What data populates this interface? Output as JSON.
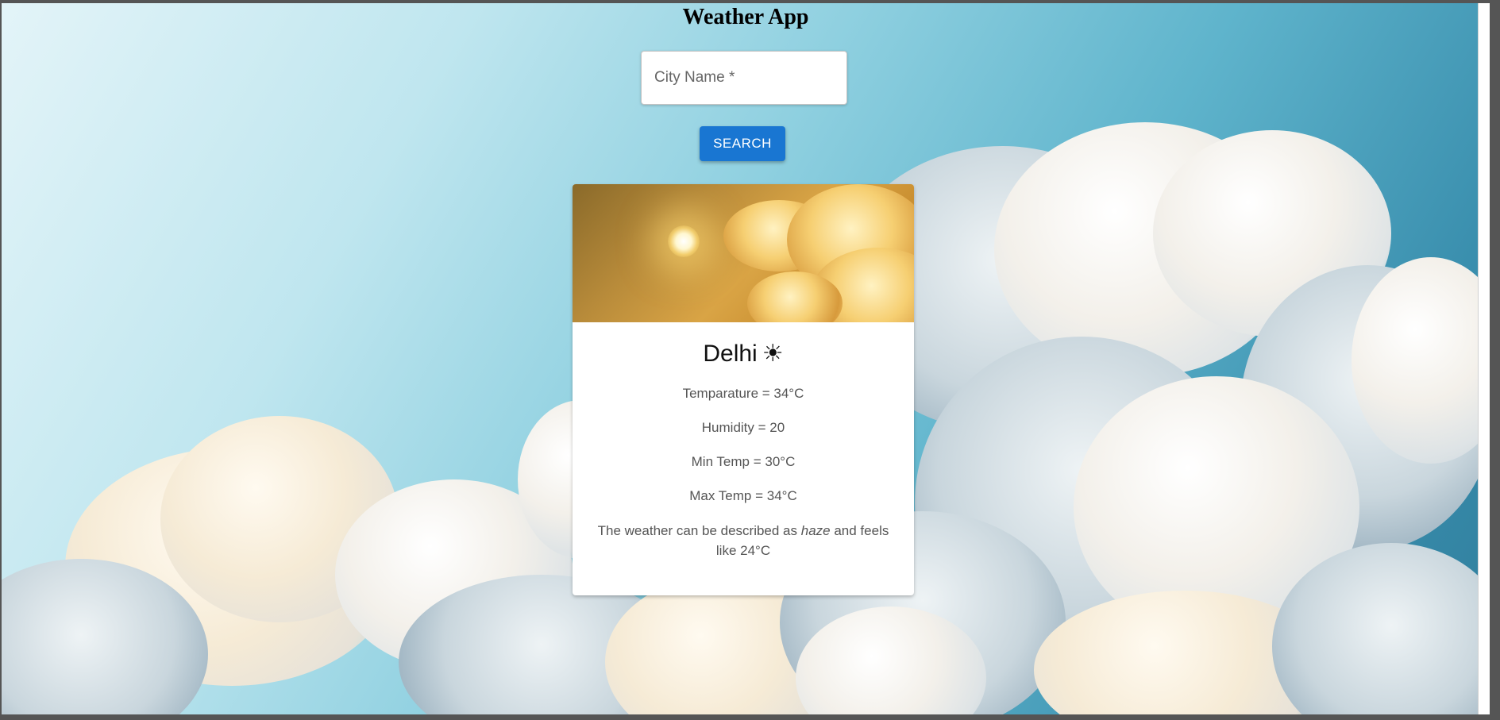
{
  "app": {
    "title": "Weather App"
  },
  "search": {
    "placeholder": "City Name *",
    "value": "",
    "button_label": "SEARCH"
  },
  "weather_card": {
    "city": "Delhi",
    "condition_icon": "sun-icon",
    "condition_glyph": "☀",
    "stats": [
      {
        "label": "Temparature = 34°C"
      },
      {
        "label": "Humidity = 20"
      },
      {
        "label": "Min Temp = 30°C"
      },
      {
        "label": "Max Temp = 34°C"
      }
    ],
    "description": {
      "prefix": "The weather can be described as ",
      "condition": "haze",
      "suffix": " and feels like 24°C"
    }
  },
  "colors": {
    "primary_button": "#1976d2",
    "card_background": "#ffffff"
  }
}
